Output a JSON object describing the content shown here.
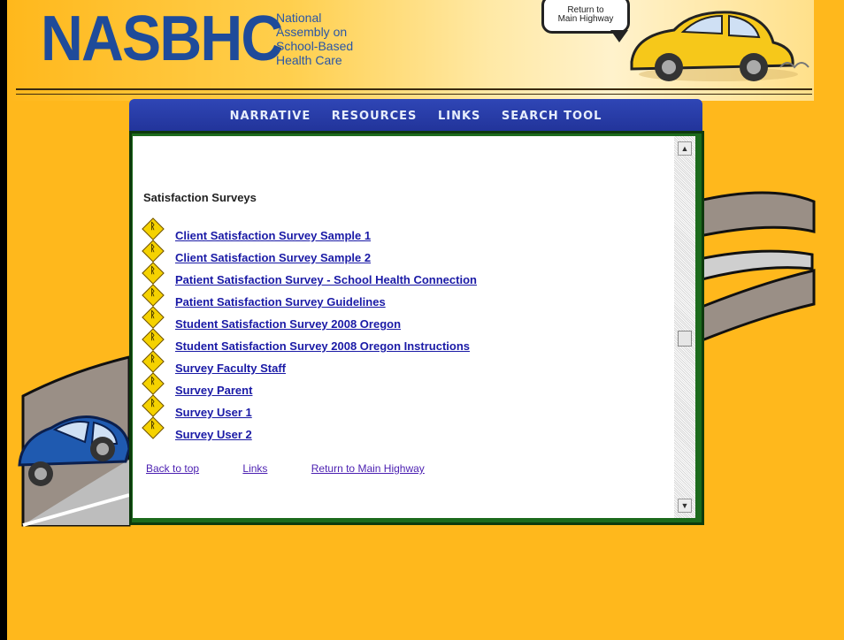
{
  "header": {
    "logo": "NASBHC",
    "logo_lines": [
      "National",
      "Assembly on",
      "School-Based",
      "Health Care"
    ],
    "bubble_lines": [
      "Return to",
      "Main Highway"
    ]
  },
  "nav": {
    "items": [
      "NARRATIVE",
      "RESOURCES",
      "LINKS",
      "SEARCH TOOL"
    ]
  },
  "content": {
    "heading": "Satisfaction Surveys",
    "links": [
      "Client Satisfaction Survey Sample 1",
      "Client Satisfaction Survey Sample 2",
      "Patient Satisfaction Survey - School Health Connection",
      "Patient Satisfaction Survey Guidelines",
      "Student Satisfaction Survey 2008 Oregon",
      "Student Satisfaction Survey 2008 Oregon Instructions",
      "Survey Faculty Staff",
      "Survey Parent",
      "Survey User 1",
      "Survey User 2"
    ],
    "footer": [
      "Back to top",
      "Links",
      "Return to Main Highway"
    ]
  },
  "colors": {
    "background": "#ffb81c",
    "nav": "#2a3fb0",
    "panel": "#1c6a1c",
    "link": "#1a1aa6",
    "footer_link": "#4b1fb1",
    "sign": "#f5d200"
  }
}
